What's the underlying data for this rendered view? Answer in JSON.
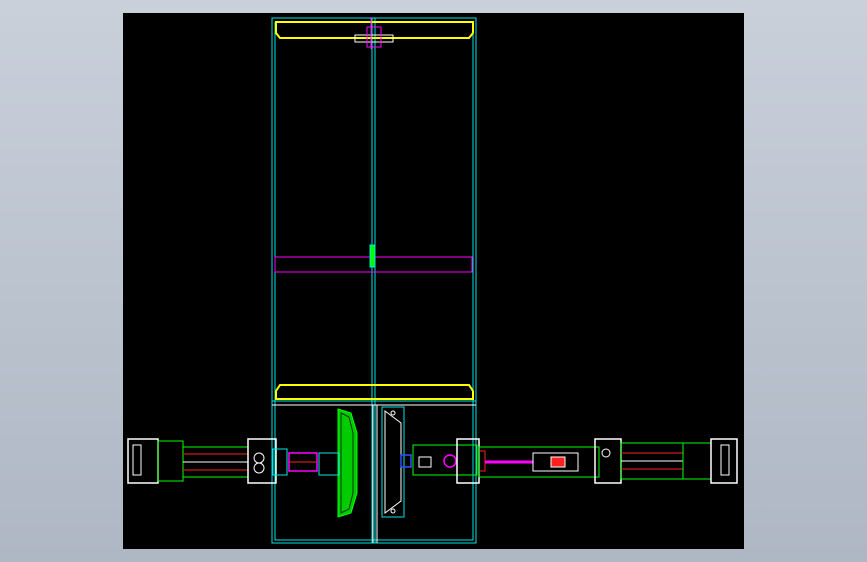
{
  "viewport": {
    "background": "#000000",
    "frame_background": "#bcc4cf"
  },
  "palette": {
    "cyan": "#00e5e5",
    "yellow": "#ffff00",
    "magenta": "#ff00ff",
    "green": "#00ff00",
    "white": "#ffffff",
    "red": "#ff2020",
    "blue": "#3050ff"
  },
  "drawing": {
    "description_icon": "cad-assembly-drawing"
  }
}
